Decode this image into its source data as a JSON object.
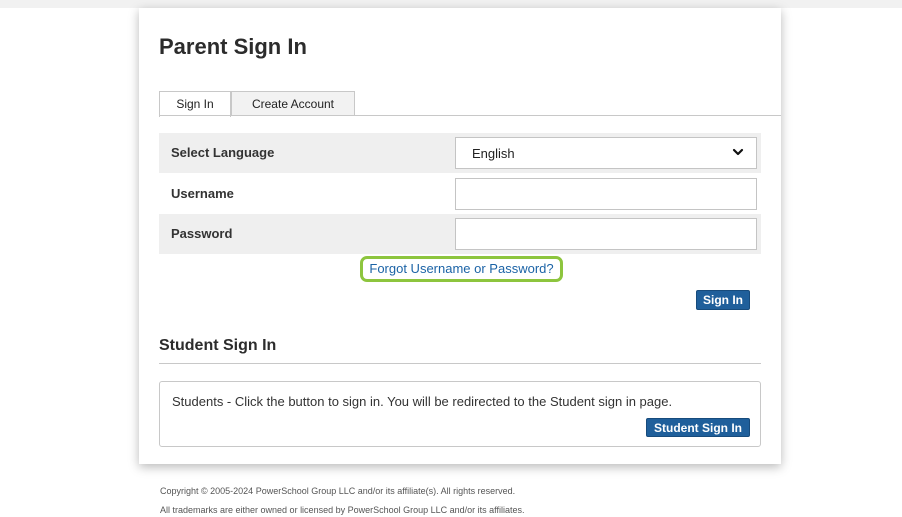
{
  "page": {
    "title": "Parent Sign In"
  },
  "tabs": [
    {
      "label": "Sign In",
      "active": true
    },
    {
      "label": "Create Account",
      "active": false
    }
  ],
  "form": {
    "language_label": "Select Language",
    "language_value": "English",
    "username_label": "Username",
    "username_value": "",
    "password_label": "Password",
    "password_value": "",
    "forgot_link": "Forgot Username or Password?",
    "signin_button": "Sign In"
  },
  "student": {
    "title": "Student Sign In",
    "message": "Students - Click the button to sign in. You will be redirected to the Student sign in page.",
    "button": "Student Sign In"
  },
  "footer": {
    "copyright": "Copyright © 2005-2024 PowerSchool Group LLC and/or its affiliate(s). All rights reserved.",
    "trademarks": "All trademarks are either owned or licensed by PowerSchool Group LLC and/or its affiliates."
  },
  "colors": {
    "accent": "#1f5f9b",
    "highlight": "#8dc53e",
    "link": "#1b63a6"
  },
  "icons": {
    "dropdown": "chevron-down-icon"
  }
}
